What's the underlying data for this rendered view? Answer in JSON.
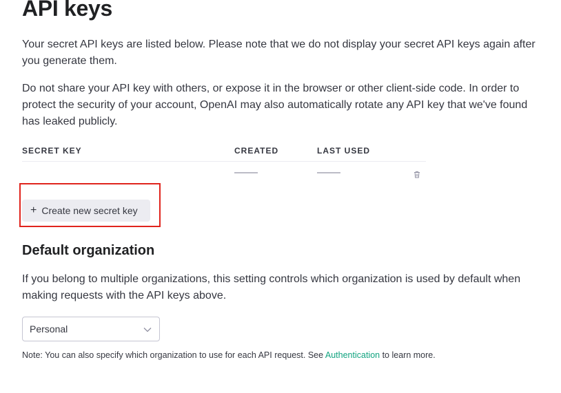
{
  "page": {
    "title": "API keys",
    "intro": "Your secret API keys are listed below. Please note that we do not display your secret API keys again after you generate them.",
    "warning": "Do not share your API key with others, or expose it in the browser or other client-side code. In order to protect the security of your account, OpenAI may also automatically rotate any API key that we've found has leaked publicly."
  },
  "table": {
    "headers": [
      "SECRET KEY",
      "CREATED",
      "LAST USED"
    ],
    "rows": [
      {
        "secret_key": "",
        "created": "",
        "last_used": "",
        "delete_icon": "trash-icon"
      }
    ]
  },
  "create_button": {
    "label": "Create new secret key",
    "icon": "plus-icon"
  },
  "organization": {
    "heading": "Default organization",
    "description": "If you belong to multiple organizations, this setting controls which organization is used by default when making requests with the API keys above.",
    "selected": "Personal",
    "note_prefix": "Note: You can also specify which organization to use for each API request. See ",
    "note_link": "Authentication",
    "note_suffix": " to learn more."
  },
  "colors": {
    "accent": "#10a37f",
    "highlight": "#e0231c",
    "button_bg": "#ececf1"
  }
}
